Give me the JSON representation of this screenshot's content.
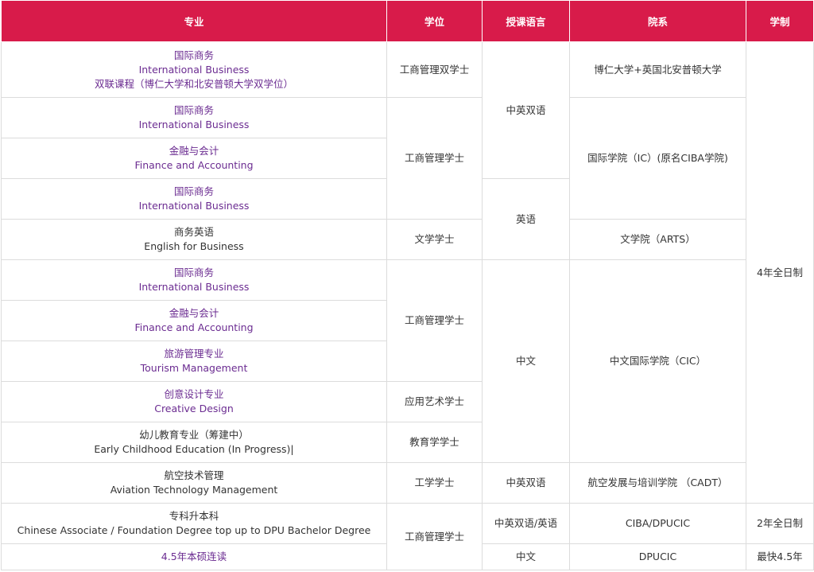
{
  "headers": {
    "major": "专业",
    "degree": "学位",
    "language": "授课语言",
    "faculty": "院系",
    "duration": "学制"
  },
  "rows": [
    {
      "major_lines": [
        "国际商务",
        "International Business",
        "双联课程（博仁大学和北安普顿大学双学位）"
      ],
      "major_linked": true
    },
    {
      "major_lines": [
        "国际商务",
        "International Business"
      ],
      "major_linked": true
    },
    {
      "major_lines": [
        "金融与会计",
        "Finance and Accounting"
      ],
      "major_linked": true
    },
    {
      "major_lines": [
        "国际商务",
        "International Business"
      ],
      "major_linked": true
    },
    {
      "major_lines": [
        "商务英语",
        "English for Business"
      ],
      "major_linked": false
    },
    {
      "major_lines": [
        "国际商务",
        "International Business"
      ],
      "major_linked": true
    },
    {
      "major_lines": [
        "金融与会计",
        "Finance and Accounting"
      ],
      "major_linked": true
    },
    {
      "major_lines": [
        "旅游管理专业",
        "Tourism Management"
      ],
      "major_linked": true
    },
    {
      "major_lines": [
        "创意设计专业",
        "Creative Design"
      ],
      "major_linked": true
    },
    {
      "major_lines": [
        "幼儿教育专业（筹建中）",
        "Early Childhood Education (In Progress)|"
      ],
      "major_linked": false
    },
    {
      "major_lines": [
        "航空技术管理",
        "Aviation Technology Management"
      ],
      "major_linked": false
    },
    {
      "major_lines": [
        "专科升本科",
        "Chinese Associate / Foundation Degree top up to DPU Bachelor Degree"
      ],
      "major_linked": false
    },
    {
      "major_lines": [
        "4.5年本硕连读"
      ],
      "major_linked": true
    }
  ],
  "degrees": {
    "d1": "工商管理双学士",
    "d2": "工商管理学士",
    "d3": "文学学士",
    "d4": "工商管理学士",
    "d5": "应用艺术学士",
    "d6": "教育学学士",
    "d7": "工学学士",
    "d8": "工商管理学士"
  },
  "languages": {
    "l1": "中英双语",
    "l2": "英语",
    "l3": "中文",
    "l4": "中英双语",
    "l5": "中英双语/英语",
    "l6": "中文"
  },
  "faculties": {
    "f1": "博仁大学+英国北安普顿大学",
    "f2": "国际学院（IC）(原名CIBA学院)",
    "f3": "文学院（ARTS）",
    "f4": "中文国际学院（CIC）",
    "f5": "航空发展与培训学院 （CADT）",
    "f6": "CIBA/DPUCIC",
    "f7": "DPUCIC"
  },
  "durations": {
    "t1": "4年全日制",
    "t2": "2年全日制",
    "t3": "最快4.5年"
  },
  "colors": {
    "header_bg": "#d81b4a",
    "header_text": "#ffffff",
    "link_text": "#6b2c91",
    "body_text": "#333333",
    "border": "#dcdcdc"
  }
}
